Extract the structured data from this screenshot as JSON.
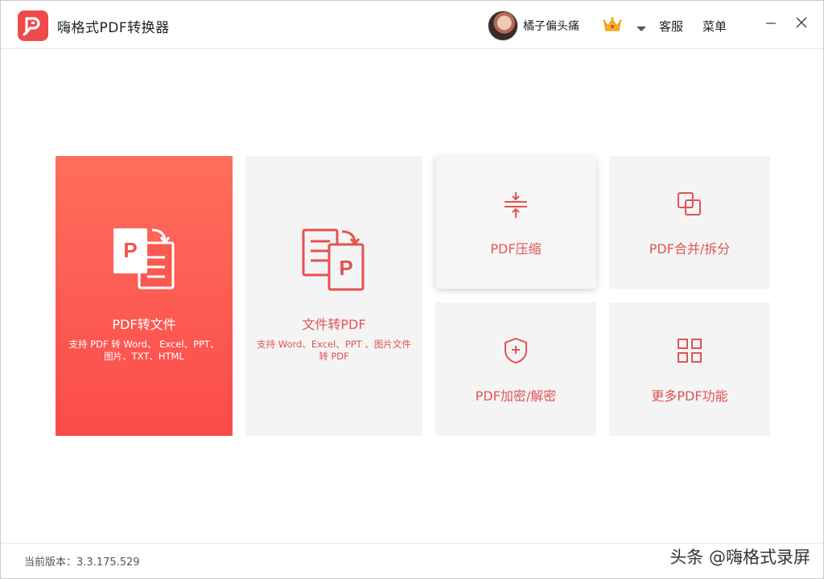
{
  "app": {
    "title": "嗨格式PDF转换器"
  },
  "user": {
    "name": "橘子偏头痛",
    "vip_icon": "crown-icon"
  },
  "header": {
    "service_label": "客服",
    "menu_label": "菜单"
  },
  "cards": [
    {
      "label": "PDF转文件",
      "desc": "支持 PDF 转 Word、 Excel、PPT、图片、TXT、HTML",
      "icon": "pdf-to-file-icon"
    },
    {
      "label": "文件转PDF",
      "desc": "支持 Word、Excel、PPT 、图片文件转 PDF",
      "icon": "file-to-pdf-icon"
    },
    {
      "label": "PDF压缩",
      "icon": "compress-icon"
    },
    {
      "label": "PDF合并/拆分",
      "icon": "merge-split-icon"
    },
    {
      "label": "PDF加密/解密",
      "icon": "shield-plus-icon"
    },
    {
      "label": "更多PDF功能",
      "icon": "grid-icon"
    }
  ],
  "footer": {
    "version_text": "当前版本：3.3.175.529"
  },
  "watermark": "头条 @嗨格式录屏",
  "colors": {
    "brand_red": "#ee4a4a",
    "card_bg": "#f4f4f4",
    "accent_text": "#e45252"
  }
}
